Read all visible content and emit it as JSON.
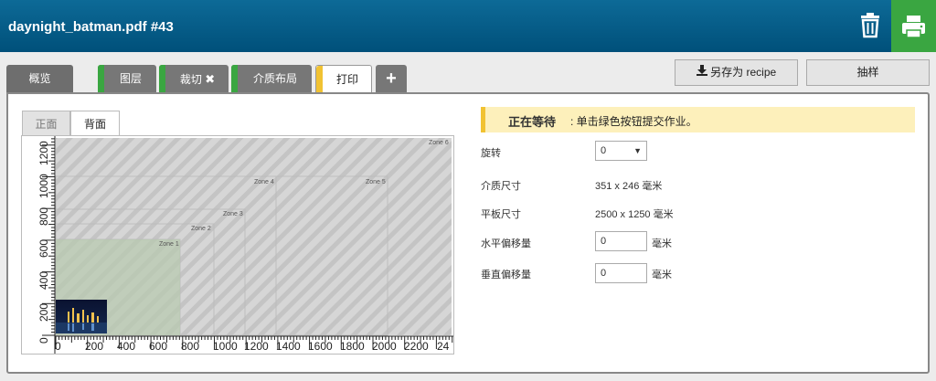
{
  "header": {
    "title": "daynight_batman.pdf #43",
    "trash_icon": "trash-icon",
    "print_icon": "printer-icon"
  },
  "tabs": [
    {
      "label": "概览"
    },
    {
      "label": "图层"
    },
    {
      "label": "裁切"
    },
    {
      "label": "介质布局"
    },
    {
      "label": "打印"
    },
    {
      "label": "+"
    }
  ],
  "toolbar": {
    "save_label": "另存为 recipe",
    "sample_label": "抽样"
  },
  "subtabs": [
    {
      "label": "正面"
    },
    {
      "label": "背面"
    }
  ],
  "canvas": {
    "x_ticks": [
      "0",
      "200",
      "400",
      "600",
      "800",
      "1000",
      "1200",
      "1400",
      "1600",
      "1800",
      "2000",
      "2200",
      "24"
    ],
    "y_ticks": [
      "0",
      "200",
      "400",
      "600",
      "800",
      "1000",
      "1200"
    ],
    "zones": [
      "Zone 1",
      "Zone 2",
      "Zone 3",
      "Zone 4",
      "Zone 5",
      "Zone 6"
    ]
  },
  "status": {
    "title": "正在等待",
    "message": ": 单击绿色按钮提交作业。"
  },
  "form": {
    "rotate_label": "旋转",
    "rotate_value": "0",
    "media_size_label": "介质尺寸",
    "media_size_value": "351 x 246 毫米",
    "bed_size_label": "平板尺寸",
    "bed_size_value": "2500 x 1250 毫米",
    "h_offset_label": "水平偏移量",
    "h_offset_value": "0",
    "v_offset_label": "垂直偏移量",
    "v_offset_value": "0",
    "unit": "毫米"
  },
  "colors": {
    "header": "#0d6a97",
    "green": "#3aa641",
    "yellow": "#f1c232"
  }
}
